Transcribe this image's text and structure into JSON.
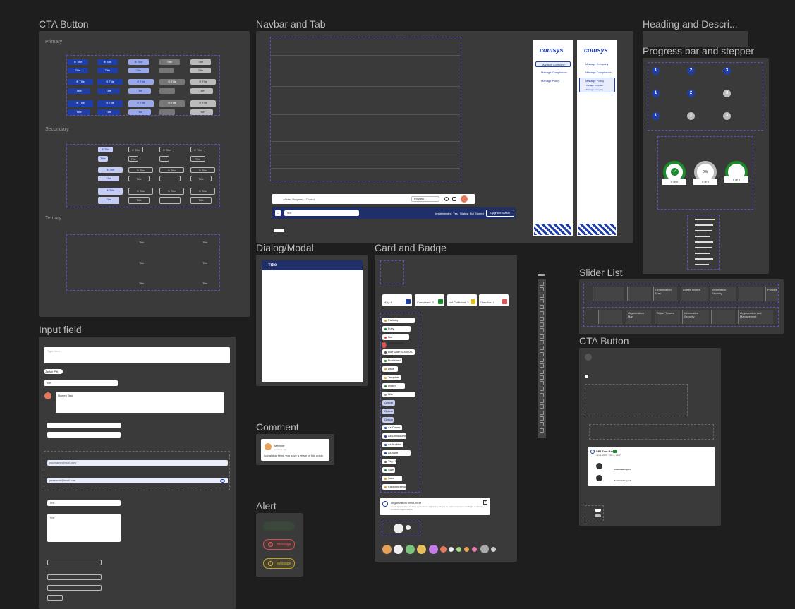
{
  "boards": {
    "cta_button": "CTA Button",
    "navbar_tab": "Navbar and Tab",
    "heading_desc": "Heading and Descri...",
    "progress": "Progress bar and stepper",
    "dialog": "Dialog/Modal",
    "card_badge": "Card and Badge",
    "slider_list": "Slider List",
    "cta_button_2": "CTA Button",
    "input_field": "Input field",
    "comment": "Comment",
    "alert": "Alert"
  },
  "cta": {
    "primary": "Primary",
    "secondary": "Secondary",
    "tertiary": "Tertiary",
    "title": "Title",
    "plus_title": "⊕ Title"
  },
  "navbar": {
    "brand": "comsys",
    "sidebar_a": [
      "Manage Company",
      "Manage Compliance",
      "Manage Policy"
    ],
    "sidebar_b": [
      "Manage Company",
      "Manage Compliance",
      "Manage Policy"
    ],
    "sub_items": [
      "Manage Template",
      "Manage Category"
    ],
    "breadcrumb": "Ahsfas Progress / Control",
    "select_label": "Polyass",
    "implemented": "Implemented: Yes",
    "status": "Status: Not Started",
    "upgrade": "Upgrade Status",
    "search_placeholder": "Text"
  },
  "dialog": {
    "title": "Title"
  },
  "card": {
    "stats": [
      {
        "label": "Ally: 6",
        "color": "#1f3ea8"
      },
      {
        "label": "Completed: 3",
        "color": "#1b8b2c"
      },
      {
        "label": "Not Collected: 3",
        "color": "#e0c020"
      },
      {
        "label": "Overdue: 4",
        "color": "#e05050"
      }
    ],
    "badges": [
      {
        "label": "Partially Implemented",
        "color": "#e0a020"
      },
      {
        "label": "Fully Implemented",
        "color": "#1b8b2c"
      },
      {
        "label": "Not Implemented",
        "color": "#e05050"
      },
      {
        "label": "",
        "color": "#e05050"
      },
      {
        "label": "Due Date: 0000-00-00",
        "color": "#555"
      },
      {
        "label": "Published",
        "color": "#1b8b2c"
      },
      {
        "label": "Draft",
        "color": "#e0a020"
      },
      {
        "label": "Template",
        "color": "#e0a020"
      },
      {
        "label": "Under Review",
        "color": "#1b8b2c"
      },
      {
        "label": "N/A",
        "color": "#999"
      },
      {
        "label": "Option",
        "color": ""
      },
      {
        "label": "Option",
        "color": ""
      },
      {
        "label": "Option",
        "color": ""
      },
      {
        "label": "As Owner",
        "color": "#1f3ea8"
      },
      {
        "label": "As Consultant",
        "color": "#1f3ea8"
      },
      {
        "label": "As Auditor",
        "color": "#1f3ea8"
      },
      {
        "label": "As Staff Company",
        "color": "#1f3ea8"
      },
      {
        "label": "Tag 10",
        "color": "#555"
      },
      {
        "label": "Start",
        "color": "#1b8b2c"
      },
      {
        "label": "Save Submit",
        "color": "#e0a020"
      },
      {
        "label": "Failed to send",
        "color": "#e0a020"
      }
    ],
    "notice_title": "Organization with Linear",
    "notice_body": "Lorem ipsum dolor sit amet consectetur adipiscing elit sed do eiusmod tempor incididunt ut labore et dolore magna aliqua."
  },
  "alert": {
    "error": "Message",
    "warning": "Message"
  },
  "comment": {
    "author": "Member",
    "time": "a minute ago",
    "body": "Any global Hmm you have a share of this guide."
  },
  "input": {
    "placeholder": "Type here...",
    "tag": "Jackie Pitt",
    "select": "Text",
    "name_title": "Name | Task",
    "email": "yourname@mail.com",
    "password": "password@mail.com",
    "dropdown": "Text",
    "dropdown2": "Text"
  },
  "progress": {
    "rings": [
      "0 of 0",
      "0 of 0",
      "0 of 0"
    ],
    "percent": "0%"
  },
  "slider": {
    "cards": [
      "Organization Man",
      "Diljeet Towers",
      "Information Security",
      "Policies",
      "Organization and Management"
    ]
  },
  "cta2": {
    "attach_title": "SR1 Dan Red",
    "attach_date": "Jan 1, 2022 - Dec 1, 2022",
    "download": "Download report"
  }
}
